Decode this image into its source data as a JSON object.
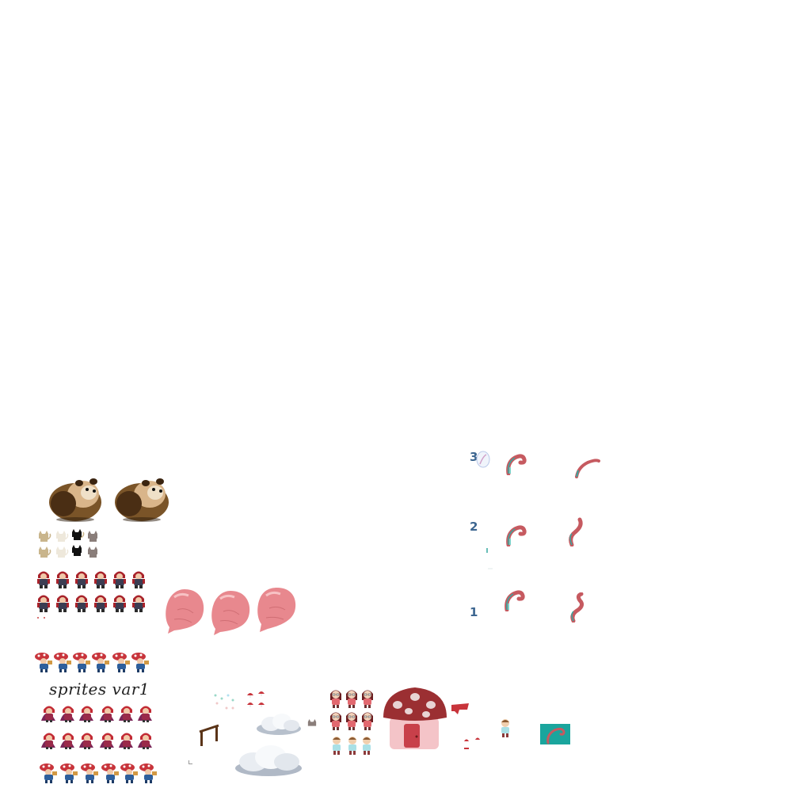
{
  "canvas": {
    "background": "#ffffff"
  },
  "labels": {
    "sprites_caption": "sprites var1",
    "row_numbers": [
      "3",
      "2",
      "1"
    ]
  },
  "assets": {
    "hamster": {
      "icon": "hamster-sprite",
      "count": 2
    },
    "cats": {
      "icon": "cat-sprite",
      "count": 8
    },
    "red_hood_rows": {
      "icon": "red-hood-character",
      "rows": 2,
      "cols": 6
    },
    "balloons": {
      "icon": "pink-balloon",
      "count": 3,
      "color": "#e8888e"
    },
    "mushroom_kid_rows": {
      "icon": "mushroom-hat-kid",
      "rows": 2,
      "cols": 6
    },
    "caped_red_hood_rows": {
      "icon": "caped-red-hood",
      "rows": 2,
      "cols": 6
    },
    "tentacle_frames": {
      "icon": "pink-tentacle",
      "count": 6,
      "color": "#c65a60",
      "accent": "#35a8a0"
    },
    "house": {
      "icon": "mushroom-house",
      "roof_color": "#9b2f32",
      "wall_color": "#f4c4c8"
    },
    "clouds": {
      "icon": "cloud",
      "count": 2
    },
    "girl_sprites": {
      "icon": "girl-sprite",
      "count": 6
    },
    "boy_sprites": {
      "icon": "boy-sprite",
      "count": 3
    },
    "teal_tile": {
      "icon": "tentacle-tile",
      "color": "#1aa59d"
    }
  }
}
